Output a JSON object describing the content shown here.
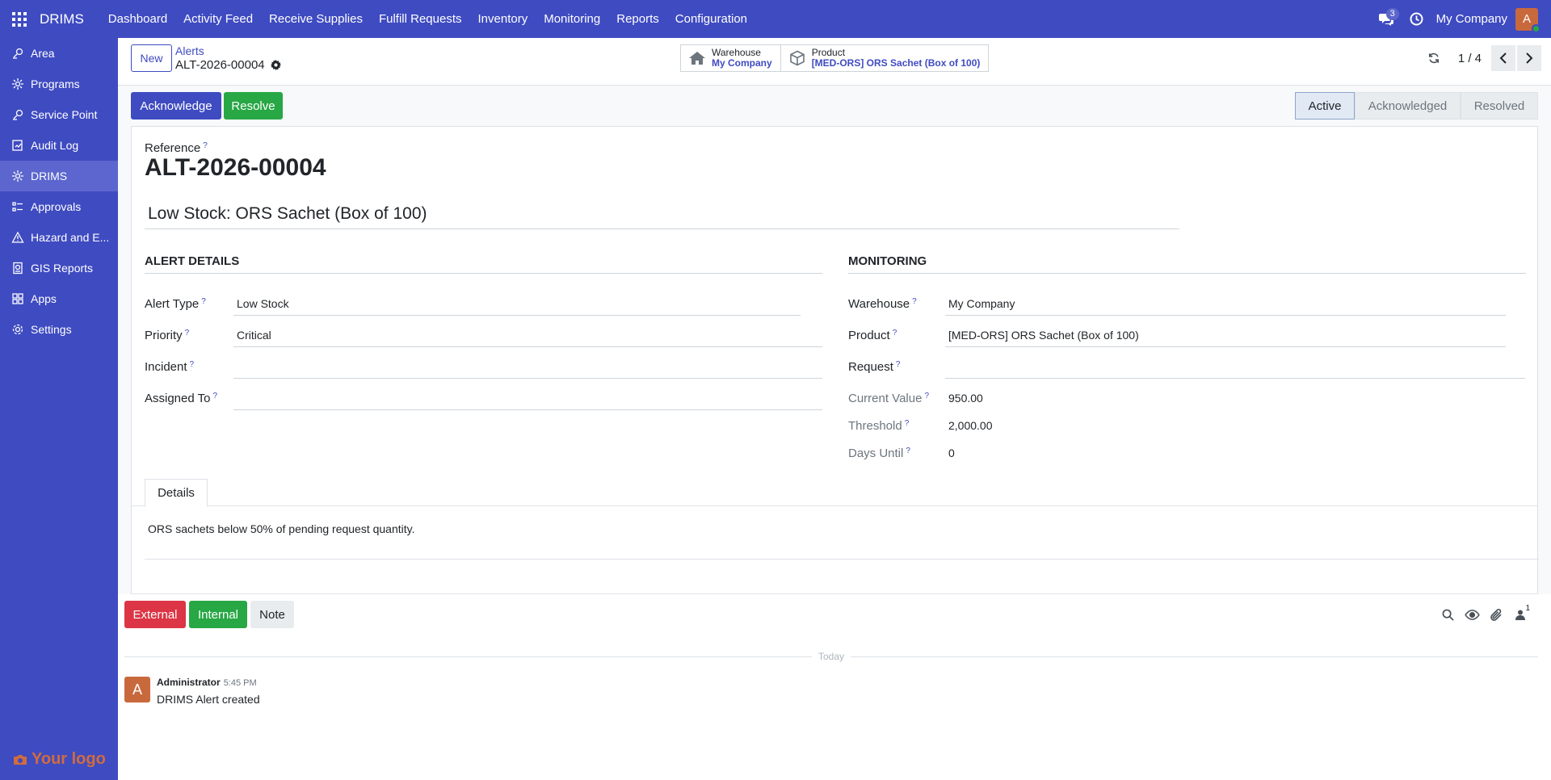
{
  "app": {
    "brand": "DRIMS",
    "menu": [
      "Dashboard",
      "Activity Feed",
      "Receive Supplies",
      "Fulfill Requests",
      "Inventory",
      "Monitoring",
      "Reports",
      "Configuration"
    ],
    "chat_count": "3",
    "company": "My Company",
    "user_initial": "A"
  },
  "sidebar": {
    "items": [
      {
        "label": "Area",
        "icon": "area-icon"
      },
      {
        "label": "Programs",
        "icon": "programs-icon"
      },
      {
        "label": "Service Point",
        "icon": "service-point-icon"
      },
      {
        "label": "Audit Log",
        "icon": "audit-log-icon"
      },
      {
        "label": "DRIMS",
        "icon": "drims-icon",
        "active": true
      },
      {
        "label": "Approvals",
        "icon": "approvals-icon"
      },
      {
        "label": "Hazard and E...",
        "icon": "hazard-icon"
      },
      {
        "label": "GIS Reports",
        "icon": "gis-reports-icon"
      },
      {
        "label": "Apps",
        "icon": "apps-icon"
      },
      {
        "label": "Settings",
        "icon": "settings-icon"
      }
    ],
    "logo_text": "Your logo"
  },
  "control_panel": {
    "new_label": "New",
    "breadcrumb": "Alerts",
    "record_name": "ALT-2026-00004",
    "smart_buttons": [
      {
        "title": "Warehouse",
        "value": "My Company",
        "icon": "home-icon"
      },
      {
        "title": "Product",
        "value": "[MED-ORS] ORS Sachet (Box of 100)",
        "icon": "cube-icon"
      }
    ],
    "pager": "1 / 4"
  },
  "actions": {
    "acknowledge": "Acknowledge",
    "resolve": "Resolve"
  },
  "statusbar": {
    "stages": [
      "Active",
      "Acknowledged",
      "Resolved"
    ],
    "current": "Active"
  },
  "form": {
    "reference_label": "Reference",
    "reference": "ALT-2026-00004",
    "name": "Low Stock: ORS Sachet (Box of 100)",
    "alert_details_title": "ALERT DETAILS",
    "monitoring_title": "MONITORING",
    "left_fields": [
      {
        "label": "Alert Type",
        "value": "Low Stock"
      },
      {
        "label": "Priority",
        "value": "Critical"
      },
      {
        "label": "Incident",
        "value": ""
      },
      {
        "label": "Assigned To",
        "value": ""
      }
    ],
    "right_fields": [
      {
        "label": "Warehouse",
        "value": "My Company"
      },
      {
        "label": "Product",
        "value": "[MED-ORS] ORS Sachet (Box of 100)"
      },
      {
        "label": "Request",
        "value": ""
      },
      {
        "label": "Current Value",
        "value": "950.00"
      },
      {
        "label": "Threshold",
        "value": "2,000.00"
      },
      {
        "label": "Days Until",
        "value": "0"
      }
    ],
    "help_mark": "?",
    "tab_label": "Details",
    "details_text": "ORS sachets below 50% of pending request quantity."
  },
  "chatter": {
    "external": "External",
    "internal": "Internal",
    "note": "Note",
    "followers": "1",
    "separator": "Today",
    "message": {
      "initial": "A",
      "author": "Administrator",
      "time": "5:45 PM",
      "body": "DRIMS Alert created"
    }
  },
  "colors": {
    "brand": "#3f4bc1",
    "success": "#28a745",
    "danger": "#dc3545",
    "avatar": "#c8693d"
  }
}
